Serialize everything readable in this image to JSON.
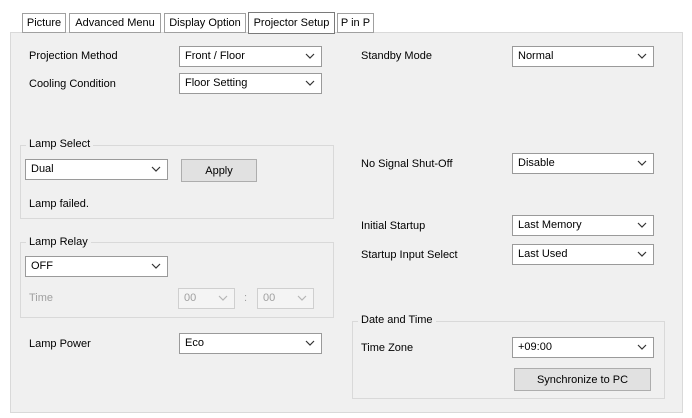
{
  "tabs": [
    {
      "label": "Picture"
    },
    {
      "label": "Advanced Menu"
    },
    {
      "label": "Display Option"
    },
    {
      "label": "Projector Setup",
      "active": true
    },
    {
      "label": "P in P"
    }
  ],
  "left": {
    "projection_method": {
      "label": "Projection Method",
      "value": "Front / Floor"
    },
    "cooling_condition": {
      "label": "Cooling Condition",
      "value": "Floor Setting"
    },
    "lamp_select": {
      "group_title": "Lamp Select",
      "value": "Dual",
      "apply_label": "Apply",
      "status": "Lamp failed."
    },
    "lamp_relay": {
      "group_title": "Lamp Relay",
      "value": "OFF",
      "time_label": "Time",
      "hour": "00",
      "separator": ":",
      "minute": "00"
    },
    "lamp_power": {
      "label": "Lamp Power",
      "value": "Eco"
    }
  },
  "right": {
    "standby_mode": {
      "label": "Standby Mode",
      "value": "Normal"
    },
    "no_signal_shutoff": {
      "label": "No Signal Shut-Off",
      "value": "Disable"
    },
    "initial_startup": {
      "label": "Initial Startup",
      "value": "Last Memory"
    },
    "startup_input_select": {
      "label": "Startup Input Select",
      "value": "Last Used"
    },
    "date_time": {
      "group_title": "Date and Time",
      "time_zone_label": "Time Zone",
      "time_zone_value": "+09:00",
      "sync_label": "Synchronize to PC"
    }
  },
  "colors": {
    "panel_bg": "#f0f0f0",
    "disabled_text": "#a0a0a0"
  },
  "icons": {
    "dropdown": "chevron-down-icon"
  }
}
